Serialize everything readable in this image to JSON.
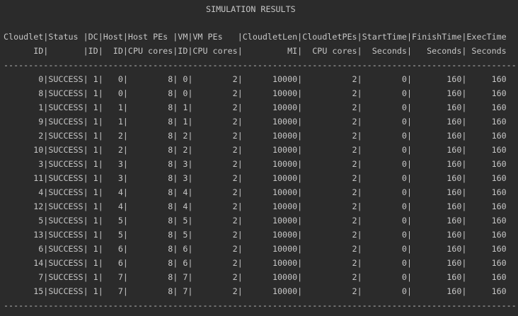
{
  "title": "SIMULATION RESULTS",
  "header_line_1": "Cloudlet|Status |DC|Host|Host PEs |VM|VM PEs   |CloudletLen|CloudletPEs|StartTime|FinishTime|ExecTime",
  "header_line_2": "      ID|       |ID|  ID|CPU cores|ID|CPU cores|         MI|  CPU cores|  Seconds|   Seconds| Seconds",
  "separator_top": "-------------------------------------------------------------------------------------------------------",
  "rows": [
    "       0|SUCCESS| 1|   0|        8| 0|        2|      10000|          2|        0|       160|     160",
    "       8|SUCCESS| 1|   0|        8| 0|        2|      10000|          2|        0|       160|     160",
    "       1|SUCCESS| 1|   1|        8| 1|        2|      10000|          2|        0|       160|     160",
    "       9|SUCCESS| 1|   1|        8| 1|        2|      10000|          2|        0|       160|     160",
    "       2|SUCCESS| 1|   2|        8| 2|        2|      10000|          2|        0|       160|     160",
    "      10|SUCCESS| 1|   2|        8| 2|        2|      10000|          2|        0|       160|     160",
    "       3|SUCCESS| 1|   3|        8| 3|        2|      10000|          2|        0|       160|     160",
    "      11|SUCCESS| 1|   3|        8| 3|        2|      10000|          2|        0|       160|     160",
    "       4|SUCCESS| 1|   4|        8| 4|        2|      10000|          2|        0|       160|     160",
    "      12|SUCCESS| 1|   4|        8| 4|        2|      10000|          2|        0|       160|     160",
    "       5|SUCCESS| 1|   5|        8| 5|        2|      10000|          2|        0|       160|     160",
    "      13|SUCCESS| 1|   5|        8| 5|        2|      10000|          2|        0|       160|     160",
    "       6|SUCCESS| 1|   6|        8| 6|        2|      10000|          2|        0|       160|     160",
    "      14|SUCCESS| 1|   6|        8| 6|        2|      10000|          2|        0|       160|     160",
    "       7|SUCCESS| 1|   7|        8| 7|        2|      10000|          2|        0|       160|     160",
    "      15|SUCCESS| 1|   7|        8| 7|        2|      10000|          2|        0|       160|     160"
  ],
  "separator_bottom": "-------------------------------------------------------------------------------------------------------"
}
